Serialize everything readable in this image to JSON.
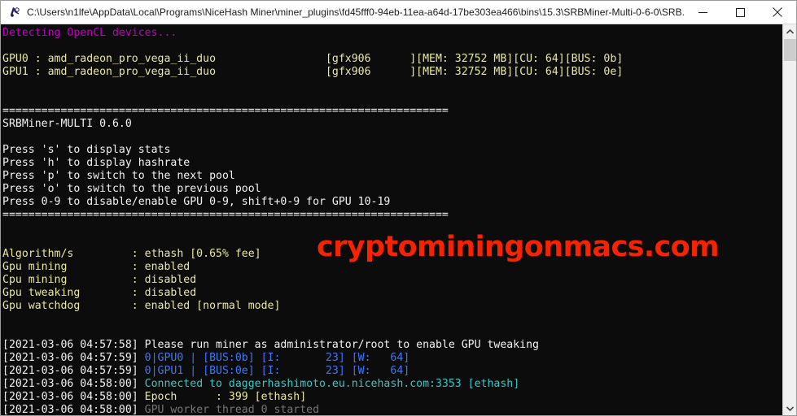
{
  "window": {
    "title": "C:\\Users\\n1lfe\\AppData\\Local\\Programs\\NiceHash Miner\\miner_plugins\\fd45fff0-94eb-11ea-a64d-17be303ea466\\bins\\15.3\\SRBMiner-Multi-0-6-0\\SRB...",
    "icon": "console-app-icon",
    "controls": {
      "minimize": "Minimize",
      "maximize": "Maximize",
      "close": "Close"
    },
    "background_color": "#0c0c0c",
    "titlebar_color": "#ffffff"
  },
  "scrollbar": {
    "up_arrow": "scroll-up-arrow",
    "down_arrow": "scroll-down-arrow",
    "thumb": "scroll-thumb"
  },
  "watermark": {
    "text": "cryptominingonmacs.com",
    "color": "#f62200"
  },
  "console": {
    "lines": [
      {
        "text": "Detecting OpenCL devices...",
        "color": "magenta"
      },
      {
        "text": "",
        "color": "ltgray"
      },
      {
        "text": "GPU0 : amd_radeon_pro_vega_ii_duo                 [gfx906      ][MEM: 32752 MB][CU: 64][BUS: 0b]",
        "color": "yellow"
      },
      {
        "text": "GPU1 : amd_radeon_pro_vega_ii_duo                 [gfx906      ][MEM: 32752 MB][CU: 64][BUS: 0e]",
        "color": "yellow"
      },
      {
        "text": "",
        "color": "ltgray"
      },
      {
        "text": "",
        "color": "ltgray"
      },
      {
        "text": "=====================================================================",
        "color": "white"
      },
      {
        "text": "SRBMiner-MULTI 0.6.0",
        "color": "white"
      },
      {
        "text": "",
        "color": "white"
      },
      {
        "text": "Press 's' to display stats",
        "color": "white"
      },
      {
        "text": "Press 'h' to display hashrate",
        "color": "white"
      },
      {
        "text": "Press 'p' to switch to the next pool",
        "color": "white"
      },
      {
        "text": "Press 'o' to switch to the previous pool",
        "color": "white"
      },
      {
        "text": "Press 0-9 to disable/enable GPU 0-9, shift+0-9 for GPU 10-19",
        "color": "white"
      },
      {
        "text": "=====================================================================",
        "color": "white"
      },
      {
        "text": "",
        "color": "white"
      },
      {
        "text": "",
        "color": "white"
      },
      {
        "text": "Algorithm/s         : ethash [0.65% fee]",
        "color": "yellow"
      },
      {
        "text": "Gpu mining          : enabled",
        "color": "yellow"
      },
      {
        "text": "Cpu mining          : disabled",
        "color": "yellow"
      },
      {
        "text": "Gpu tweaking        : disabled",
        "color": "yellow"
      },
      {
        "text": "Gpu watchdog        : enabled [normal mode]",
        "color": "yellow"
      },
      {
        "text": "",
        "color": "yellow"
      },
      {
        "text": "",
        "color": "yellow"
      }
    ],
    "log_lines": [
      {
        "timestamp": "[2021-03-06 04:57:58]",
        "message": "Please run miner as administrator/root to enable GPU tweaking",
        "color": "white"
      },
      {
        "timestamp": "[2021-03-06 04:57:59]",
        "message": "0|GPU0 | [BUS:0b] [I:       23] [W:   64]",
        "color": "blue"
      },
      {
        "timestamp": "[2021-03-06 04:57:59]",
        "message": "0|GPU1 | [BUS:0e] [I:       23] [W:   64]",
        "color": "blue"
      },
      {
        "timestamp": "[2021-03-06 04:58:00]",
        "message": "Connected to daggerhashimoto.eu.nicehash.com:3353 [ethash]",
        "color": "cyan"
      },
      {
        "timestamp": "[2021-03-06 04:58:00]",
        "message": "Epoch      : 399 [ethash]",
        "color": "yellow"
      },
      {
        "timestamp": "[2021-03-06 04:58:00]",
        "message": "GPU worker thread 0 started",
        "color": "gray"
      }
    ]
  }
}
